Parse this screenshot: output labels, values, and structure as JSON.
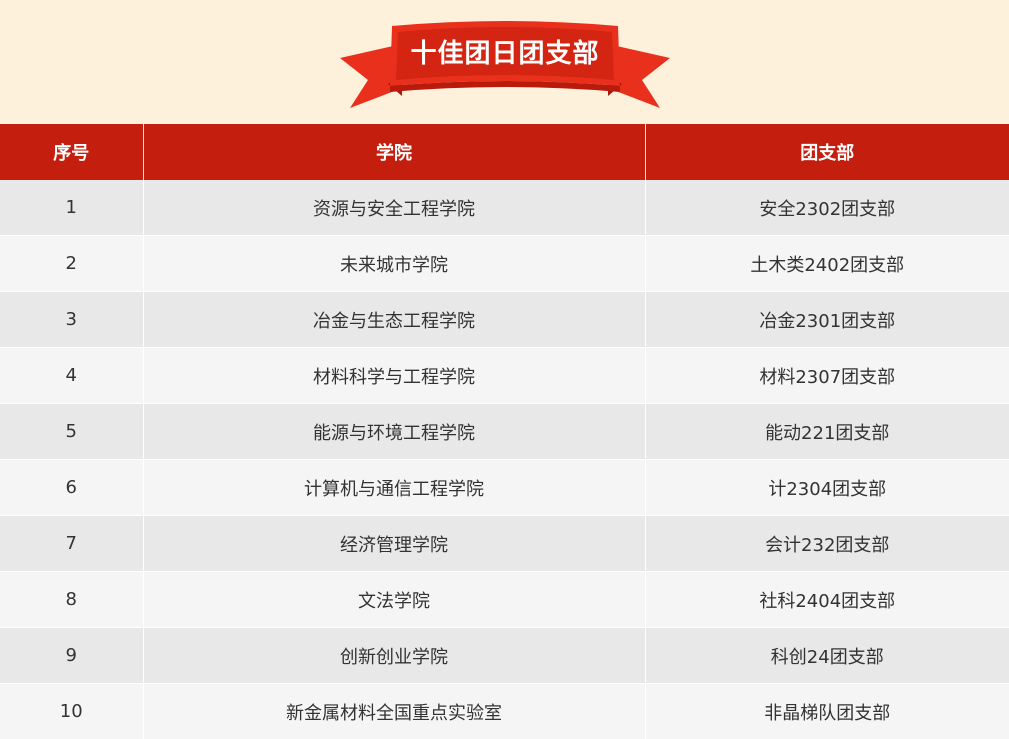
{
  "banner": {
    "title": "十佳团日团支部",
    "colors": {
      "ribbon": "#e8301c",
      "ribbon_dark": "#b81a0c",
      "background": "#fdf1dc"
    }
  },
  "table": {
    "headers": [
      "序号",
      "学院",
      "团支部"
    ],
    "header_color": "#c41e0e",
    "rows": [
      [
        "1",
        "资源与安全工程学院",
        "安全2302团支部"
      ],
      [
        "2",
        "未来城市学院",
        "土木类2402团支部"
      ],
      [
        "3",
        "冶金与生态工程学院",
        "冶金2301团支部"
      ],
      [
        "4",
        "材料科学与工程学院",
        "材料2307团支部"
      ],
      [
        "5",
        "能源与环境工程学院",
        "能动221团支部"
      ],
      [
        "6",
        "计算机与通信工程学院",
        "计2304团支部"
      ],
      [
        "7",
        "经济管理学院",
        "会计232团支部"
      ],
      [
        "8",
        "文法学院",
        "社科2404团支部"
      ],
      [
        "9",
        "创新创业学院",
        "科创24团支部"
      ],
      [
        "10",
        "新金属材料全国重点实验室",
        "非晶梯队团支部"
      ]
    ]
  }
}
